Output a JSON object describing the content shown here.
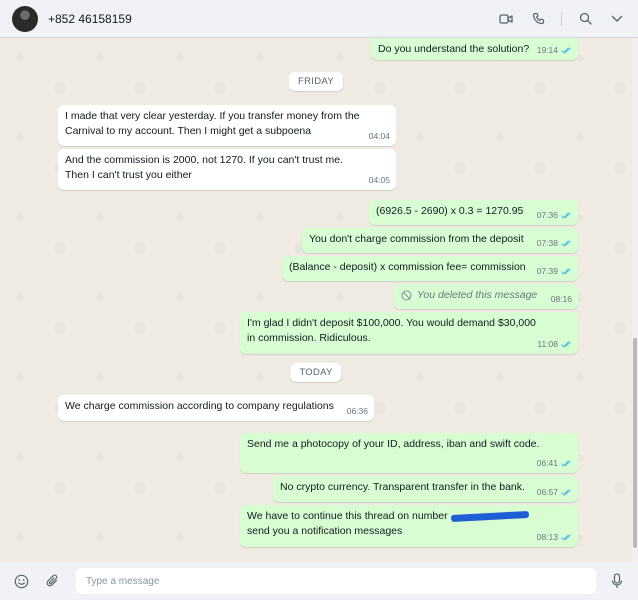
{
  "header": {
    "contact_name": "+852 46158159",
    "icons": [
      "video-icon",
      "phone-icon",
      "search-icon",
      "menu-icon"
    ]
  },
  "chat": {
    "date_labels": {
      "friday": "FRIDAY",
      "today": "TODAY"
    },
    "messages": [
      {
        "dir": "out",
        "text": "Do you understand the solution?",
        "time": "19:14",
        "ticks": "read"
      },
      {
        "dir": "in",
        "text": "I made that very clear yesterday. If you transfer money from the Carnival to my account. Then I might get a subpoena",
        "time": "04:04"
      },
      {
        "dir": "in",
        "text": "And the commission is 2000, not 1270. If you can't trust me. Then I can't trust you either",
        "time": "04:05"
      },
      {
        "dir": "out",
        "text": "(6926.5 - 2690) x 0.3 = 1270.95",
        "time": "07:36",
        "ticks": "read"
      },
      {
        "dir": "out",
        "text": "You don't charge commission from the deposit",
        "time": "07:38",
        "ticks": "read"
      },
      {
        "dir": "out",
        "text": "(Balance - deposit) x commission fee= commission",
        "time": "07:39",
        "ticks": "read"
      },
      {
        "dir": "out",
        "text": "You deleted this message",
        "time": "08:16",
        "deleted": true
      },
      {
        "dir": "out",
        "text": "I'm glad I didn't deposit $100,000. You would demand $30,000 in commission. Ridiculous.",
        "time": "11:08",
        "ticks": "read"
      },
      {
        "dir": "in",
        "text": "We charge commission according to company regulations",
        "time": "06:36"
      },
      {
        "dir": "out",
        "text": "Send me a photocopy of your ID, address, iban and swift code.",
        "time": "06:41",
        "ticks": "read"
      },
      {
        "dir": "out",
        "text": "No crypto currency. Transparent transfer in the bank.",
        "time": "06:57",
        "ticks": "read"
      },
      {
        "dir": "out",
        "text_before": "We have to continue this thread on number",
        "text_after": "send you a notification messages",
        "time": "08:13",
        "ticks": "read"
      }
    ]
  },
  "composer": {
    "placeholder": "Type a message",
    "icons": [
      "emoji-icon",
      "attach-icon",
      "mic-icon"
    ]
  },
  "colors": {
    "outgoing_bubble": "#d9fdd3",
    "incoming_bubble": "#ffffff",
    "chat_background": "#efeae2",
    "read_tick": "#53bdeb"
  }
}
